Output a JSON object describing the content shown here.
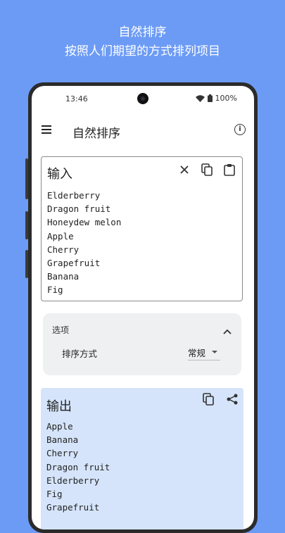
{
  "promo": {
    "title": "自然排序",
    "subtitle": "按照人们期望的方式排列项目"
  },
  "status_bar": {
    "time": "13:46",
    "battery": "100%"
  },
  "app_bar": {
    "title": "自然排序"
  },
  "input_card": {
    "title": "输入",
    "items": [
      "Elderberry",
      "Dragon fruit",
      "Honeydew melon",
      "Apple",
      "Cherry",
      "Grapefruit",
      "Banana",
      "Fig"
    ]
  },
  "options": {
    "label": "选项",
    "sort_method_label": "排序方式",
    "sort_method_value": "常规"
  },
  "output_card": {
    "title": "输出",
    "items": [
      "Apple",
      "Banana",
      "Cherry",
      "Dragon fruit",
      "Elderberry",
      "Fig",
      "Grapefruit"
    ]
  },
  "colors": {
    "background": "#6c9bf5",
    "output_background": "#d5e4fa",
    "options_background": "#eef0f1"
  }
}
